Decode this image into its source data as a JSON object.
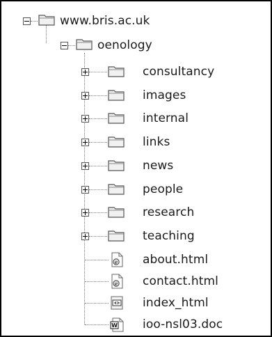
{
  "tree": {
    "root": {
      "label": "www.bris.ac.uk",
      "icon": "folder-icon",
      "state": "expanded"
    },
    "child": {
      "label": "oenology",
      "icon": "folder-icon",
      "state": "expanded"
    },
    "items": [
      {
        "label": "consultancy",
        "icon": "folder-icon",
        "state": "collapsed"
      },
      {
        "label": "images",
        "icon": "folder-icon",
        "state": "collapsed"
      },
      {
        "label": "internal",
        "icon": "folder-icon",
        "state": "collapsed"
      },
      {
        "label": "links",
        "icon": "folder-icon",
        "state": "collapsed"
      },
      {
        "label": "news",
        "icon": "folder-icon",
        "state": "collapsed"
      },
      {
        "label": "people",
        "icon": "folder-icon",
        "state": "collapsed"
      },
      {
        "label": "research",
        "icon": "folder-icon",
        "state": "collapsed"
      },
      {
        "label": "teaching",
        "icon": "folder-icon",
        "state": "collapsed"
      },
      {
        "label": "about.html",
        "icon": "html-file-icon",
        "state": "leaf"
      },
      {
        "label": "contact.html",
        "icon": "html-file-icon",
        "state": "leaf"
      },
      {
        "label": "index_html",
        "icon": "web-file-icon",
        "state": "leaf"
      },
      {
        "label": "ioo-nsl03.doc",
        "icon": "word-document-icon",
        "state": "leaf"
      }
    ]
  }
}
